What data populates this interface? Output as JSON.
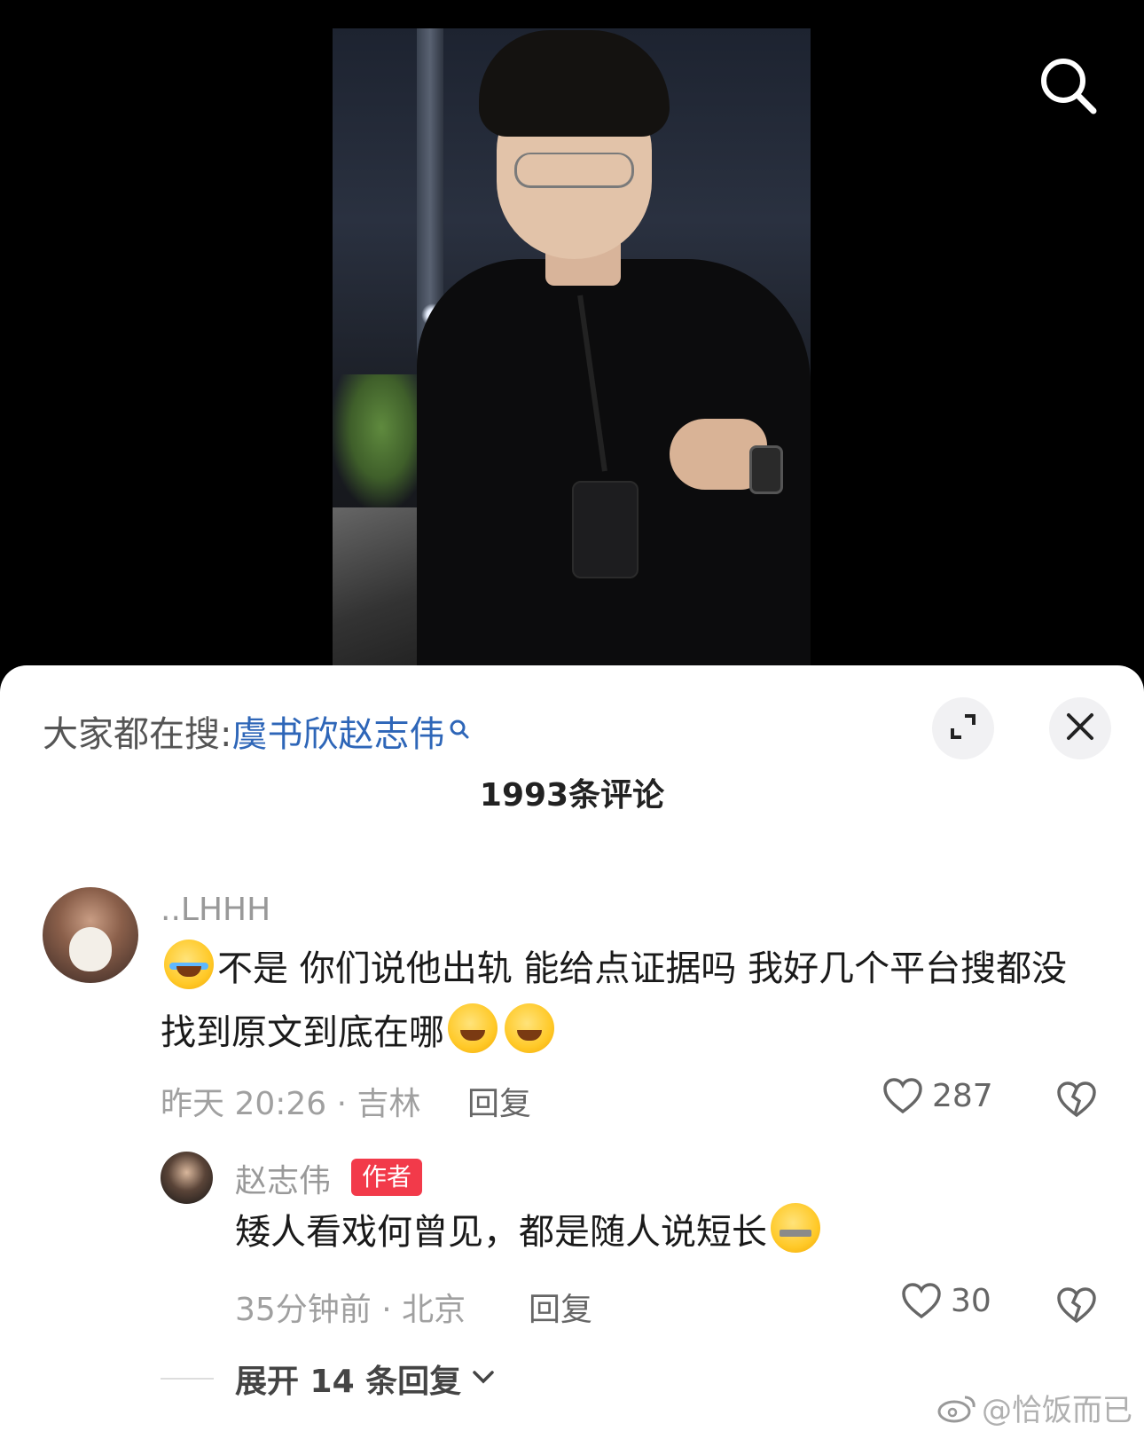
{
  "hot_search": {
    "prefix": "大家都在搜:",
    "query": "虞书欣赵志伟"
  },
  "comments_header": {
    "count_label": "1993条评论"
  },
  "comments": [
    {
      "username": "..LHHH",
      "text_before_emoji": "不是 你们说他出轨 能给点证据吗 我好几个平台搜都没找到原文到底在哪",
      "meta": "昨天 20:26 · 吉林",
      "reply_label": "回复",
      "likes": "287"
    },
    {
      "username": "赵志伟",
      "badge": "作者",
      "text": "矮人看戏何曾见，都是随人说短长",
      "meta": "35分钟前 · 北京",
      "reply_label": "回复",
      "likes": "30"
    }
  ],
  "expand_replies": {
    "label": "展开 14 条回复"
  },
  "watermark": {
    "text": "@恰饭而已"
  },
  "icons": [
    "search-icon",
    "expand-icon",
    "close-icon",
    "heart-icon",
    "broken-heart-icon",
    "chevron-down-icon",
    "weibo-logo-icon"
  ],
  "colors": {
    "link": "#2e66b8",
    "author_badge": "#f23a4a"
  }
}
